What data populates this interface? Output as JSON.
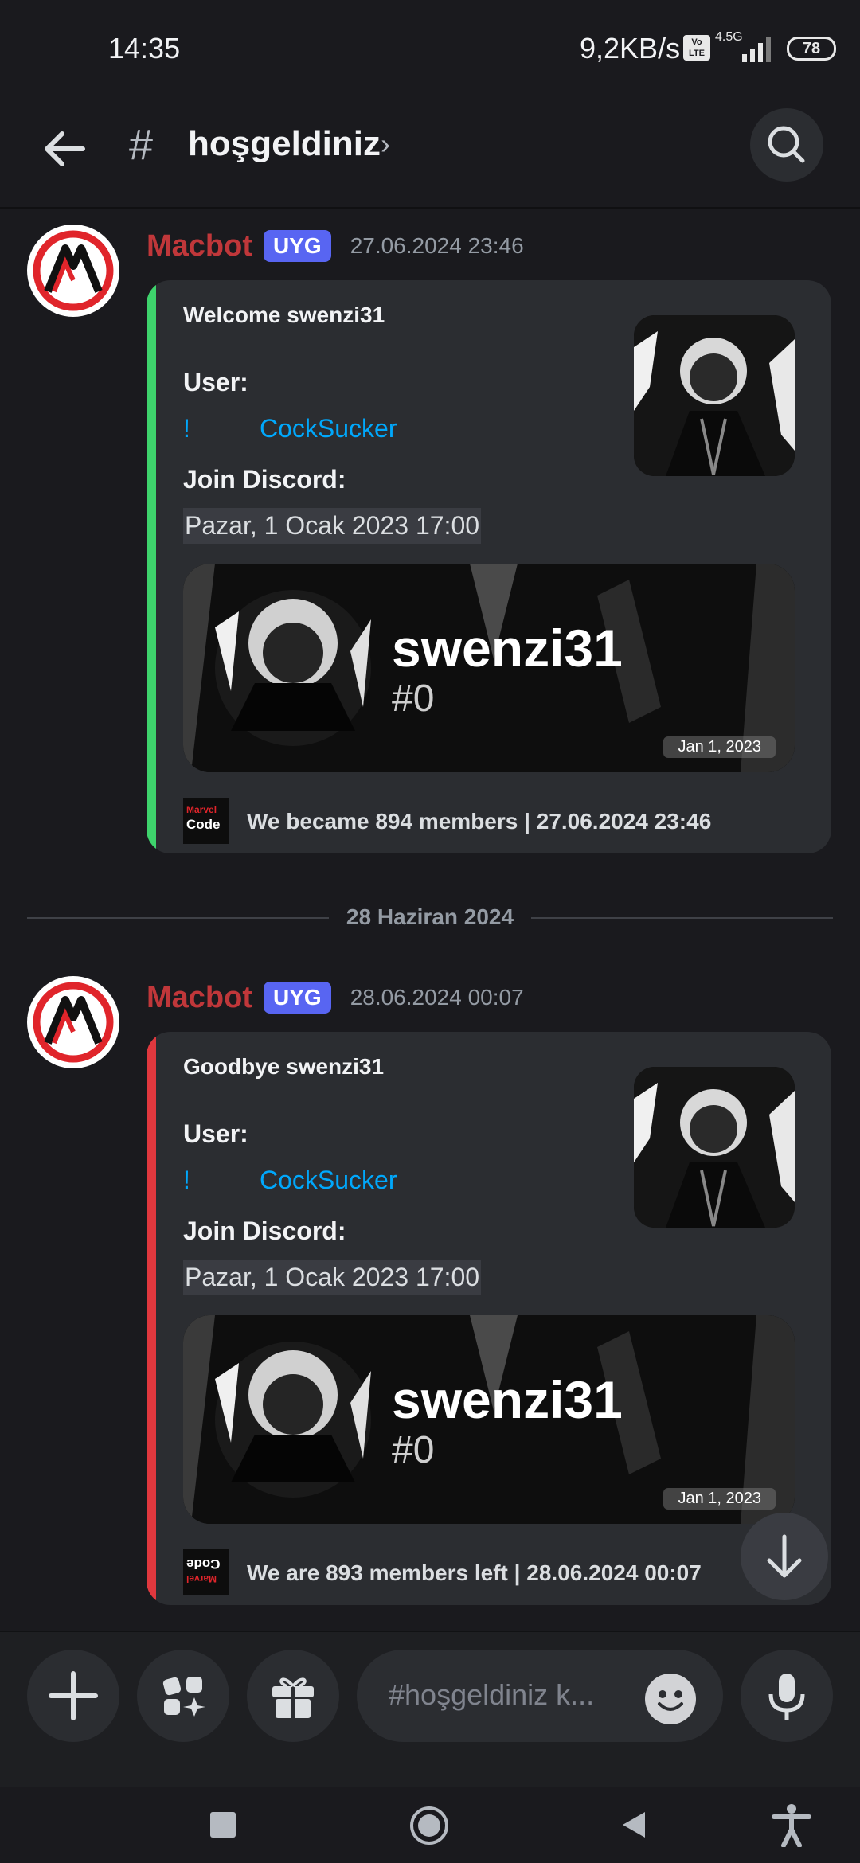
{
  "status_bar": {
    "time": "14:35",
    "speed": "9,2KB/s",
    "volte": "Vo LTE",
    "network": "4.5G",
    "battery": "78"
  },
  "header": {
    "channel_name": "hoşgeldiniz",
    "chevron": "›"
  },
  "messages": [
    {
      "author": "Macbot",
      "tag": "UYG",
      "timestamp": "27.06.2024 23:46",
      "embed": {
        "accent": "#3ed36c",
        "title": "Welcome swenzi31",
        "user_label": "User:",
        "mention_prefix": "!",
        "mention_name": "CockSucker",
        "join_label": "Join Discord:",
        "join_date": "Pazar, 1 Ocak 2023 17:00",
        "banner_name": "swenzi31",
        "banner_tag": "#0",
        "banner_date": "Jan 1, 2023",
        "footer": "We became 894 members | 27.06.2024 23:46"
      }
    },
    {
      "author": "Macbot",
      "tag": "UYG",
      "timestamp": "28.06.2024 00:07",
      "embed": {
        "accent": "#e0383e",
        "title": "Goodbye swenzi31",
        "user_label": "User:",
        "mention_prefix": "!",
        "mention_name": "CockSucker",
        "join_label": "Join Discord:",
        "join_date": "Pazar, 1 Ocak 2023 17:00",
        "banner_name": "swenzi31",
        "banner_tag": "#0",
        "banner_date": "Jan 1, 2023",
        "footer": "We are 893 members left | 28.06.2024 00:07"
      }
    }
  ],
  "day_divider": "28 Haziran 2024",
  "composer": {
    "placeholder": "#hoşgeldiniz k..."
  },
  "footer_icon_text": {
    "top": "Marvel",
    "bottom": "Code"
  },
  "icons": [
    "back-arrow-icon",
    "hash-icon",
    "search-icon",
    "plus-icon",
    "apps-icon",
    "gift-icon",
    "emoji-icon",
    "microphone-icon",
    "arrow-down-icon",
    "recents-icon",
    "home-icon",
    "back-icon",
    "accessibility-icon"
  ]
}
